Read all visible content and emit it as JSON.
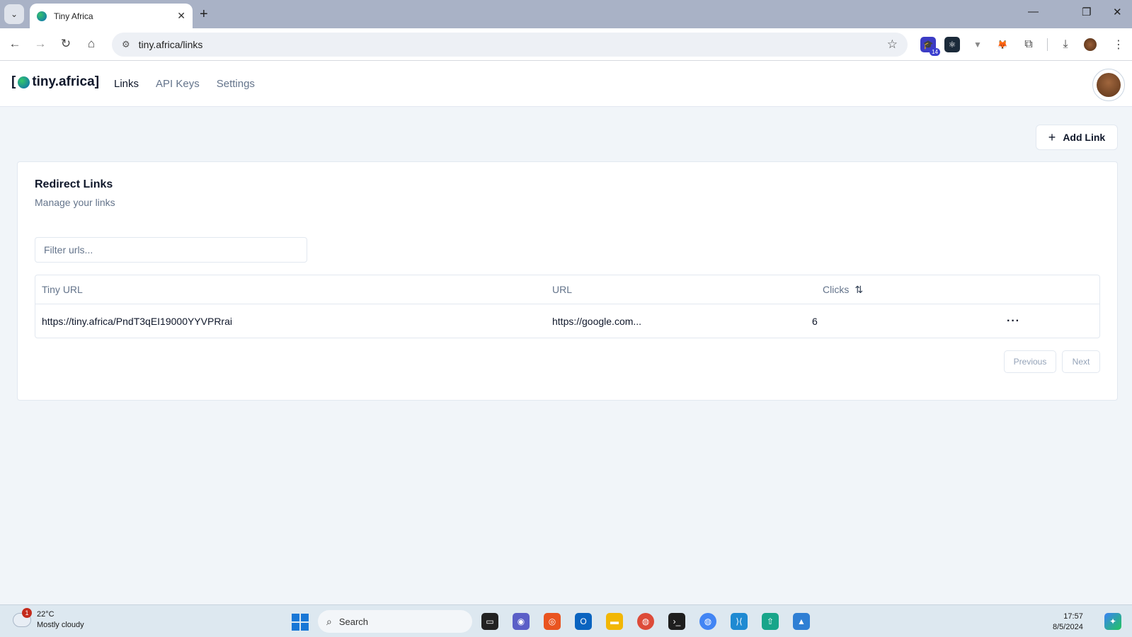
{
  "browser": {
    "tab_title": "Tiny Africa",
    "url": "tiny.africa/links",
    "icons": [
      "tab-list-icon",
      "globe-favicon",
      "close-icon",
      "plus-icon",
      "back-icon",
      "forward-icon",
      "reload-icon",
      "home-icon",
      "site-info-icon",
      "star-icon",
      "puzzle-icon",
      "download-icon",
      "kebab-icon"
    ],
    "extension_badge": "14"
  },
  "app": {
    "logo_open": "[",
    "logo_text": "tiny.africa",
    "logo_close": "]",
    "nav": [
      {
        "label": "Links",
        "active": true
      },
      {
        "label": "API Keys",
        "active": false
      },
      {
        "label": "Settings",
        "active": false
      }
    ]
  },
  "actions": {
    "add_link_label": "Add Link"
  },
  "card": {
    "title": "Redirect Links",
    "description": "Manage your links",
    "filter_placeholder": "Filter urls..."
  },
  "table": {
    "columns": [
      "Tiny URL",
      "URL",
      "Clicks"
    ],
    "rows": [
      {
        "tiny_url": "https://tiny.africa/PndT3qEI19000YYVPRrai",
        "url": "https://google.com...",
        "clicks": "6",
        "actions": "···"
      }
    ]
  },
  "pagination": {
    "previous": "Previous",
    "next": "Next"
  },
  "taskbar": {
    "weather_badge": "1",
    "temperature": "22°C",
    "condition": "Mostly cloudy",
    "search_label": "Search",
    "time": "17:57",
    "date": "8/5/2024"
  },
  "colors": {
    "page_bg": "#f1f5f9",
    "text_primary": "#0f172a",
    "text_muted": "#64748b",
    "border": "#e2e8f0"
  }
}
